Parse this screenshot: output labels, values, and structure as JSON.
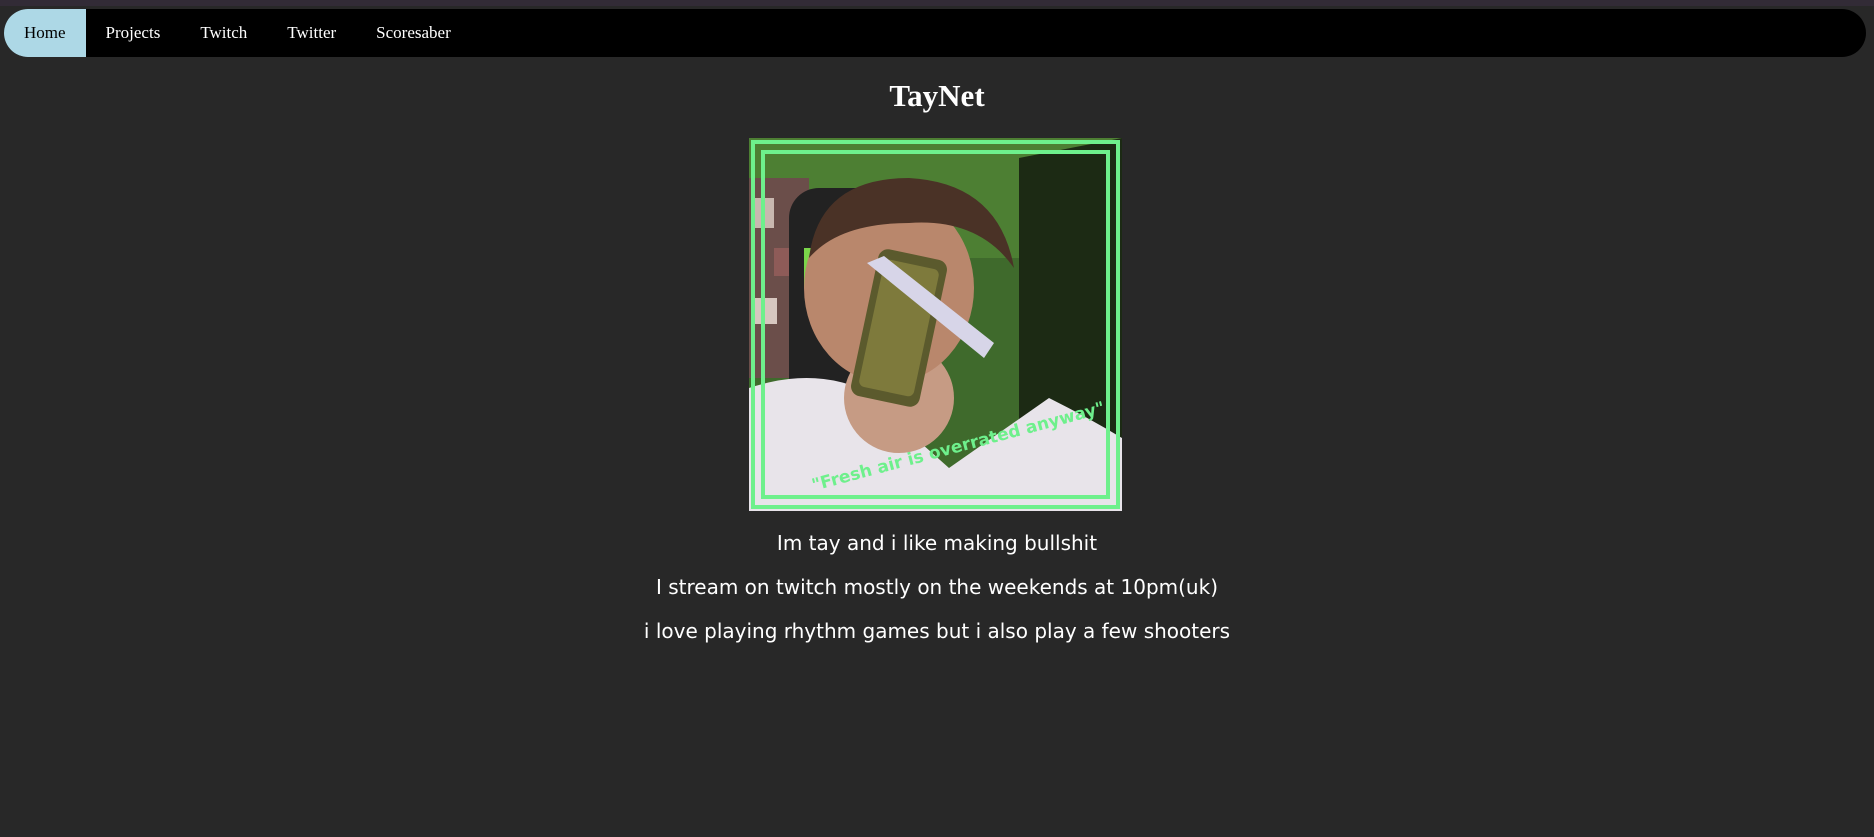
{
  "nav": {
    "items": [
      {
        "label": "Home",
        "active": true
      },
      {
        "label": "Projects",
        "active": false
      },
      {
        "label": "Twitch",
        "active": false
      },
      {
        "label": "Twitter",
        "active": false
      },
      {
        "label": "Scoresaber",
        "active": false
      }
    ]
  },
  "main": {
    "title": "TayNet",
    "photo": {
      "caption": "\"Fresh air is overrated anyway\""
    },
    "bio": [
      "Im tay and i like making bullshit",
      "I stream on twitch mostly on the weekends at 10pm(uk)",
      "i love playing rhythm games but i also play a few shooters"
    ]
  },
  "colors": {
    "background": "#282828",
    "navbar": "#000000",
    "active_tab": "#add8e6",
    "frame_green": "#6ef08c"
  }
}
